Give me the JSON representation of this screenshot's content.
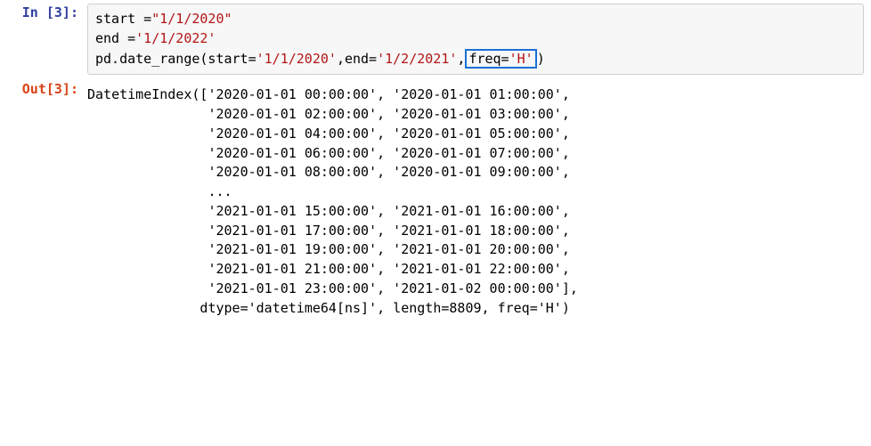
{
  "input": {
    "prompt_label": "In [3]:",
    "line1_a": "start =",
    "line1_b": "\"1/1/2020\"",
    "line2_a": "end =",
    "line2_b": "'1/1/2022'",
    "line3_a": "pd.date_range(start=",
    "line3_b": "'1/1/2020'",
    "line3_c": ",end=",
    "line3_d": "'1/2/2021'",
    "line3_e": ",",
    "line3_freq_key": "freq=",
    "line3_freq_val": "'H'",
    "line3_f": ")"
  },
  "output": {
    "prompt_label": "Out[3]:",
    "line1": "DatetimeIndex(['2020-01-01 00:00:00', '2020-01-01 01:00:00',",
    "line2": "               '2020-01-01 02:00:00', '2020-01-01 03:00:00',",
    "line3": "               '2020-01-01 04:00:00', '2020-01-01 05:00:00',",
    "line4": "               '2020-01-01 06:00:00', '2020-01-01 07:00:00',",
    "line5": "               '2020-01-01 08:00:00', '2020-01-01 09:00:00',",
    "line6": "               ...",
    "line7": "               '2021-01-01 15:00:00', '2021-01-01 16:00:00',",
    "line8": "               '2021-01-01 17:00:00', '2021-01-01 18:00:00',",
    "line9": "               '2021-01-01 19:00:00', '2021-01-01 20:00:00',",
    "line10": "               '2021-01-01 21:00:00', '2021-01-01 22:00:00',",
    "line11": "               '2021-01-01 23:00:00', '2021-01-02 00:00:00'],",
    "line12": "              dtype='datetime64[ns]', length=8809, freq='H')"
  }
}
